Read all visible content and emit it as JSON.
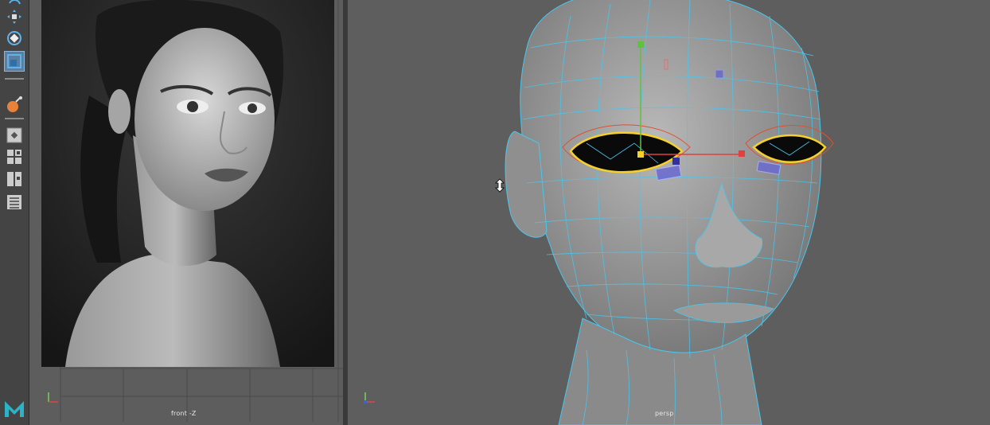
{
  "toolbox": {
    "tools": [
      {
        "name": "rotate-tool",
        "icon": "rotate-icon"
      },
      {
        "name": "move-tool",
        "icon": "move-icon"
      },
      {
        "name": "rotate-tool",
        "icon": "rotate-icon"
      },
      {
        "name": "scale-tool",
        "icon": "scale-icon",
        "active": true
      },
      {
        "name": "last-used-tool",
        "icon": "paint-effects-icon"
      },
      {
        "name": "single-view-layout",
        "icon": "single-pane-icon"
      },
      {
        "name": "four-view-layout",
        "icon": "four-pane-icon"
      },
      {
        "name": "two-view-layout",
        "icon": "two-pane-icon"
      },
      {
        "name": "outliner-layout",
        "icon": "outliner-icon"
      }
    ],
    "logo_icon": "maya-logo-icon"
  },
  "viewports": {
    "left": {
      "camera_label": "front -Z"
    },
    "right": {
      "camera_label": "persp"
    }
  },
  "colors": {
    "accent": "#5c7ea0",
    "wireframe": "#46c8f0",
    "selection": "#f5d12a",
    "logo": "#2bb3c8"
  }
}
